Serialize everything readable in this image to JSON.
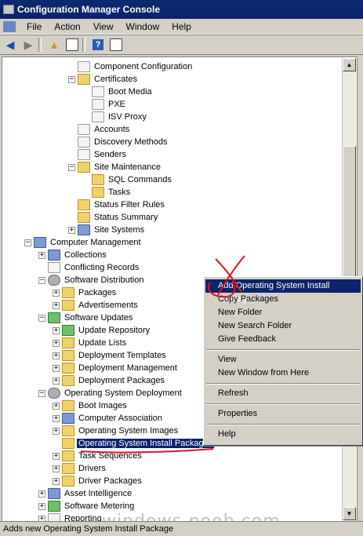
{
  "window": {
    "title": "Configuration Manager Console"
  },
  "menubar": {
    "items": [
      "File",
      "Action",
      "View",
      "Window",
      "Help"
    ]
  },
  "toolbar": {
    "buttons": [
      "back-arrow-icon",
      "forward-arrow-icon",
      "up-folder-icon",
      "show-hide-tree-icon",
      "help-icon",
      "properties-icon"
    ]
  },
  "tree": {
    "items": [
      {
        "label": "Component Configuration",
        "level": 4,
        "icon": "doc",
        "expander": "none"
      },
      {
        "label": "Certificates",
        "level": 4,
        "icon": "folder",
        "expander": "minus"
      },
      {
        "label": "Boot Media",
        "level": 5,
        "icon": "doc",
        "expander": "none"
      },
      {
        "label": "PXE",
        "level": 5,
        "icon": "doc",
        "expander": "none"
      },
      {
        "label": "ISV Proxy",
        "level": 5,
        "icon": "doc",
        "expander": "none"
      },
      {
        "label": "Accounts",
        "level": 4,
        "icon": "doc",
        "expander": "none"
      },
      {
        "label": "Discovery Methods",
        "level": 4,
        "icon": "doc",
        "expander": "none"
      },
      {
        "label": "Senders",
        "level": 4,
        "icon": "doc",
        "expander": "none"
      },
      {
        "label": "Site Maintenance",
        "level": 4,
        "icon": "folder",
        "expander": "minus"
      },
      {
        "label": "SQL Commands",
        "level": 5,
        "icon": "folder",
        "expander": "none"
      },
      {
        "label": "Tasks",
        "level": 5,
        "icon": "folder",
        "expander": "none"
      },
      {
        "label": "Status Filter Rules",
        "level": 4,
        "icon": "folder",
        "expander": "none"
      },
      {
        "label": "Status Summary",
        "level": 4,
        "icon": "folder",
        "expander": "none"
      },
      {
        "label": "Site Systems",
        "level": 4,
        "icon": "comp",
        "expander": "plus"
      },
      {
        "label": "Computer Management",
        "level": 1,
        "icon": "comp",
        "expander": "minus"
      },
      {
        "label": "Collections",
        "level": 2,
        "icon": "comp",
        "expander": "plus"
      },
      {
        "label": "Conflicting Records",
        "level": 2,
        "icon": "doc",
        "expander": "none"
      },
      {
        "label": "Software Distribution",
        "level": 2,
        "icon": "gear",
        "expander": "minus"
      },
      {
        "label": "Packages",
        "level": 3,
        "icon": "folder",
        "expander": "plus"
      },
      {
        "label": "Advertisements",
        "level": 3,
        "icon": "folder",
        "expander": "plus"
      },
      {
        "label": "Software Updates",
        "level": 2,
        "icon": "green",
        "expander": "minus"
      },
      {
        "label": "Update Repository",
        "level": 3,
        "icon": "green",
        "expander": "plus"
      },
      {
        "label": "Update Lists",
        "level": 3,
        "icon": "folder",
        "expander": "plus"
      },
      {
        "label": "Deployment Templates",
        "level": 3,
        "icon": "folder",
        "expander": "plus"
      },
      {
        "label": "Deployment Management",
        "level": 3,
        "icon": "folder",
        "expander": "plus"
      },
      {
        "label": "Deployment Packages",
        "level": 3,
        "icon": "folder",
        "expander": "plus"
      },
      {
        "label": "Operating System Deployment",
        "level": 2,
        "icon": "gear",
        "expander": "minus"
      },
      {
        "label": "Boot Images",
        "level": 3,
        "icon": "folder",
        "expander": "plus"
      },
      {
        "label": "Computer Association",
        "level": 3,
        "icon": "comp",
        "expander": "plus"
      },
      {
        "label": "Operating System Images",
        "level": 3,
        "icon": "folder",
        "expander": "plus"
      },
      {
        "label": "Operating System Install Packages",
        "level": 3,
        "icon": "folder",
        "expander": "none",
        "selected": true
      },
      {
        "label": "Task Sequences",
        "level": 3,
        "icon": "folder",
        "expander": "plus"
      },
      {
        "label": "Drivers",
        "level": 3,
        "icon": "folder",
        "expander": "plus"
      },
      {
        "label": "Driver Packages",
        "level": 3,
        "icon": "folder",
        "expander": "plus"
      },
      {
        "label": "Asset Intelligence",
        "level": 2,
        "icon": "comp",
        "expander": "plus"
      },
      {
        "label": "Software Metering",
        "level": 2,
        "icon": "green",
        "expander": "plus"
      },
      {
        "label": "Reporting",
        "level": 2,
        "icon": "doc",
        "expander": "plus"
      }
    ]
  },
  "context_menu": {
    "items": [
      {
        "label": "Add Operating System Install Package",
        "highlighted": true
      },
      {
        "label": "Copy Packages"
      },
      {
        "label": "New Folder"
      },
      {
        "label": "New Search Folder"
      },
      {
        "label": "Give Feedback"
      },
      {
        "separator": true
      },
      {
        "label": "View"
      },
      {
        "label": "New Window from Here"
      },
      {
        "separator": true
      },
      {
        "label": "Refresh"
      },
      {
        "separator": true
      },
      {
        "label": "Properties"
      },
      {
        "separator": true
      },
      {
        "label": "Help"
      }
    ]
  },
  "statusbar": {
    "text": "Adds new Operating System Install Package"
  },
  "watermark": {
    "text": "windows-noob.com"
  },
  "colors": {
    "selection": "#0a246a",
    "annotation": "#e0141e",
    "window_face": "#d4d0c8"
  }
}
